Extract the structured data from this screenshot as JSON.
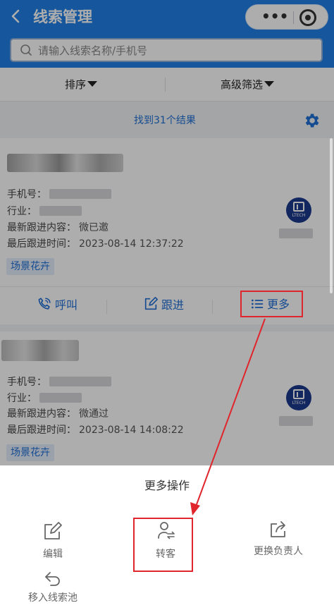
{
  "header": {
    "title": "线索管理",
    "back_icon": "chevron-left-icon",
    "menu_icon": "more-dots-icon",
    "close_icon": "target-icon"
  },
  "search": {
    "placeholder": "请输入线索名称/手机号"
  },
  "filter": {
    "sort_label": "排序",
    "advanced_label": "高级筛选"
  },
  "results": {
    "summary": "找到31个结果"
  },
  "colors": {
    "primary": "#1f7fe6",
    "link": "#1f6fd6",
    "highlight": "#e0252c"
  },
  "labels": {
    "phone": "手机号：",
    "industry": "行业：",
    "latest_followup": "最新跟进内容：",
    "last_followup_time": "最后跟进时间："
  },
  "cards": [
    {
      "latest_followup_value": "微已邀",
      "last_followup_time_value": "2023-08-14 12:37:22",
      "tag": "场景花卉",
      "logo_text": "LTECH"
    },
    {
      "latest_followup_value": "微通过",
      "last_followup_time_value": "2023-08-14 14:08:22",
      "tag": "场景花卉",
      "logo_text": "LTECH"
    }
  ],
  "actions": {
    "call": "呼叫",
    "followup": "跟进",
    "more": "更多"
  },
  "sheet": {
    "title": "更多操作",
    "edit": "编辑",
    "transfer": "转客",
    "change_owner": "更换负责人",
    "move_to_pool": "移入线索池"
  }
}
